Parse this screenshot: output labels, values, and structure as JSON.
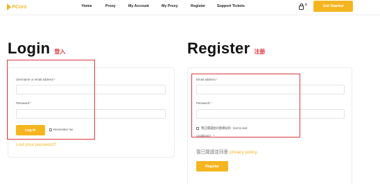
{
  "header": {
    "logo_text": "PCors",
    "nav": [
      "Home",
      "Proxy",
      "My Account",
      "My Proxy",
      "Register",
      "Support Tickets"
    ],
    "cart_count": "0",
    "get_started_label": "Get Started"
  },
  "login": {
    "title": "Login",
    "title_cn": "登入",
    "username_label": "Username or email address",
    "username_value": "",
    "password_label": "Password",
    "password_value": "",
    "required_mark": "*",
    "login_button": "Log in",
    "remember_label": "Remember me",
    "remember_checked": false,
    "lost_password": "Lost your password?"
  },
  "register": {
    "title": "Register",
    "title_cn": "注册",
    "email_label": "Email address",
    "email_value": "",
    "password_label": "Password",
    "password_value": "",
    "required_mark": "*",
    "terms_label": "我已閱讀並同意網站的（terms and",
    "terms_label_2": "conditions）",
    "privacy_prefix": "我已閱讀並同意",
    "privacy_link": "privacy policy.",
    "register_button": "Register"
  },
  "colors": {
    "accent": "#f5b51f",
    "highlight": "#e0363a",
    "required": "#e0363a"
  }
}
